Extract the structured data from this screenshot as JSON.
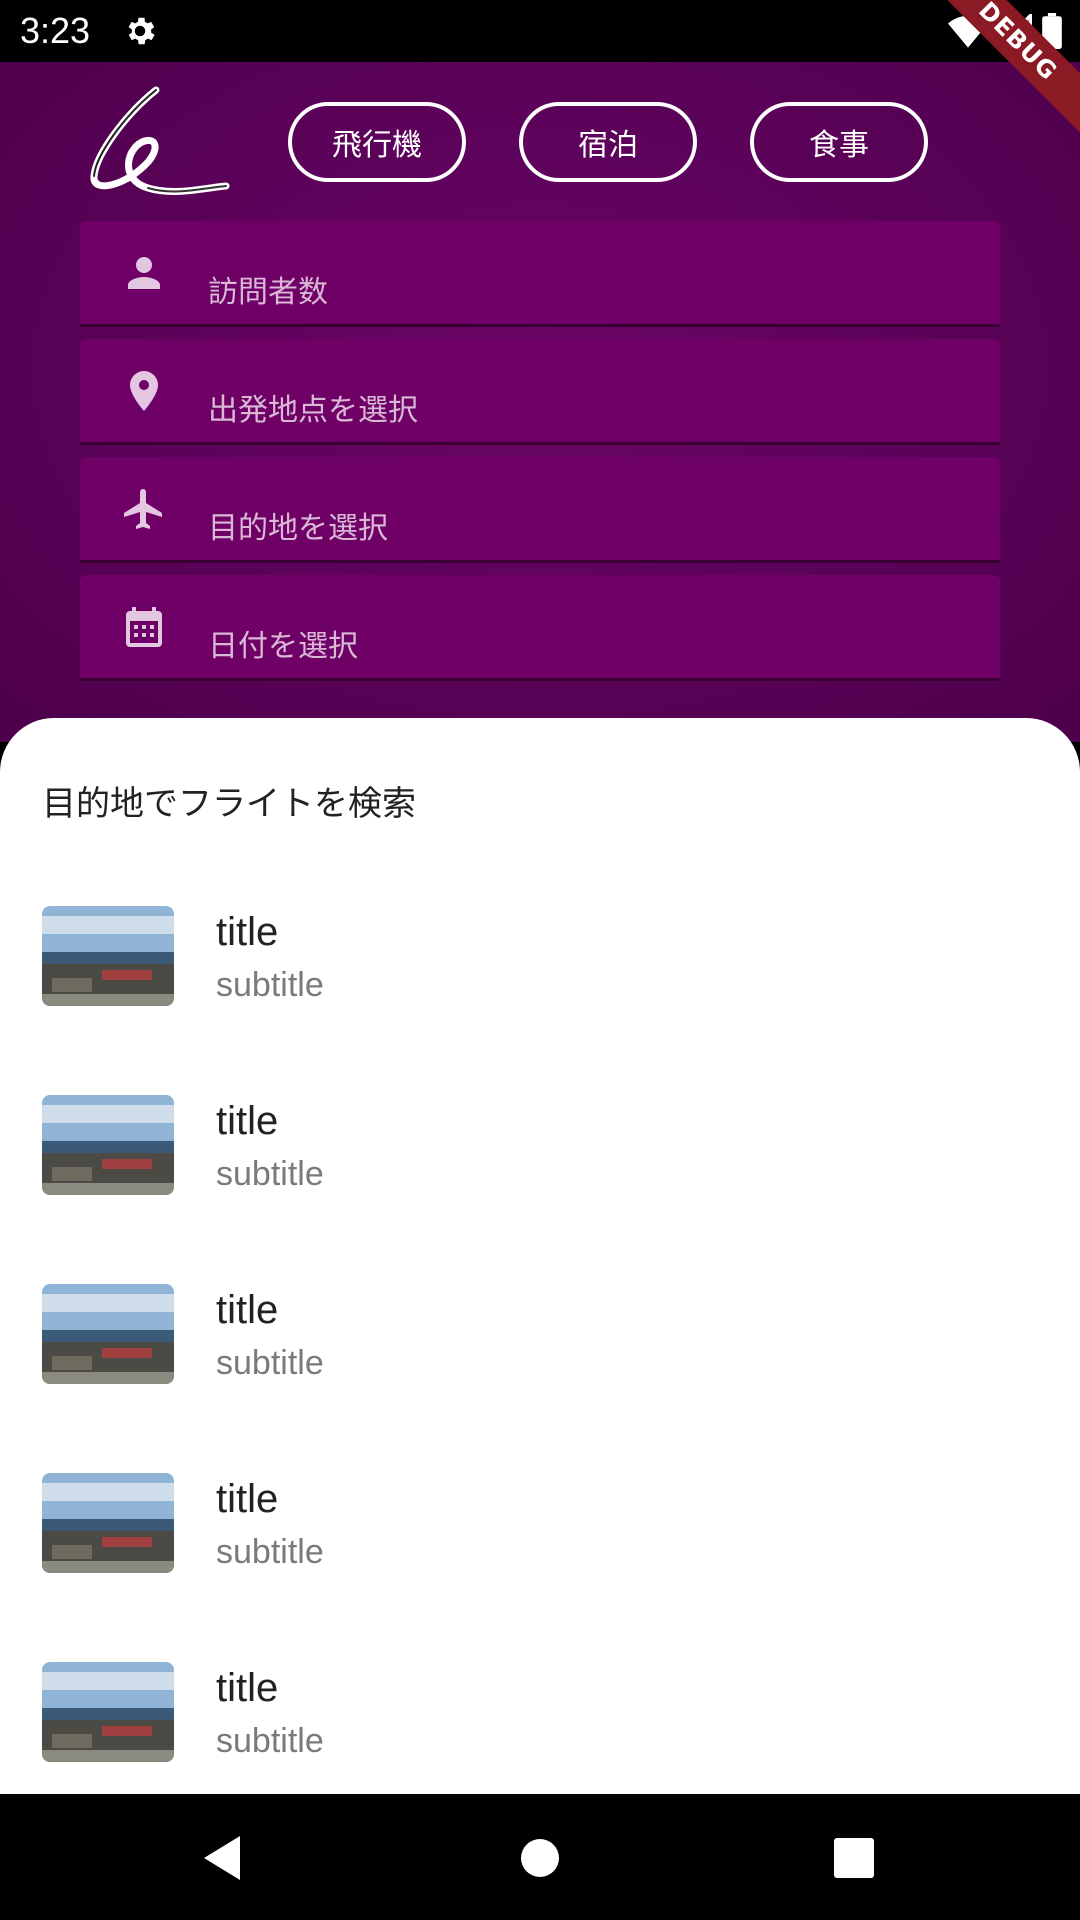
{
  "status_bar": {
    "time": "3:23",
    "icons": [
      "settings-gear-icon",
      "wifi-icon",
      "cell-signal-icon",
      "battery-icon"
    ],
    "debug_label": "DEBUG"
  },
  "header": {
    "logo": "brand-logo",
    "tabs": [
      {
        "label": "飛行機"
      },
      {
        "label": "宿泊"
      },
      {
        "label": "食事"
      }
    ],
    "fields": [
      {
        "icon": "person-icon",
        "placeholder": "訪問者数"
      },
      {
        "icon": "location-pin-icon",
        "placeholder": "出発地点を選択"
      },
      {
        "icon": "airplane-icon",
        "placeholder": "目的地を選択"
      },
      {
        "icon": "calendar-icon",
        "placeholder": "日付を選択"
      }
    ]
  },
  "sheet": {
    "title": "目的地でフライトを検索",
    "items": [
      {
        "title": "title",
        "subtitle": "subtitle"
      },
      {
        "title": "title",
        "subtitle": "subtitle"
      },
      {
        "title": "title",
        "subtitle": "subtitle"
      },
      {
        "title": "title",
        "subtitle": "subtitle"
      },
      {
        "title": "title",
        "subtitle": "subtitle"
      }
    ]
  },
  "nav_bar": {
    "icons": [
      "back-icon",
      "home-icon",
      "recents-icon"
    ]
  },
  "colors": {
    "header_bg": "#5a0258",
    "field_bg": "#6f0166",
    "field_text": "#d9b8d6",
    "debug_banner": "#8b1a25"
  }
}
